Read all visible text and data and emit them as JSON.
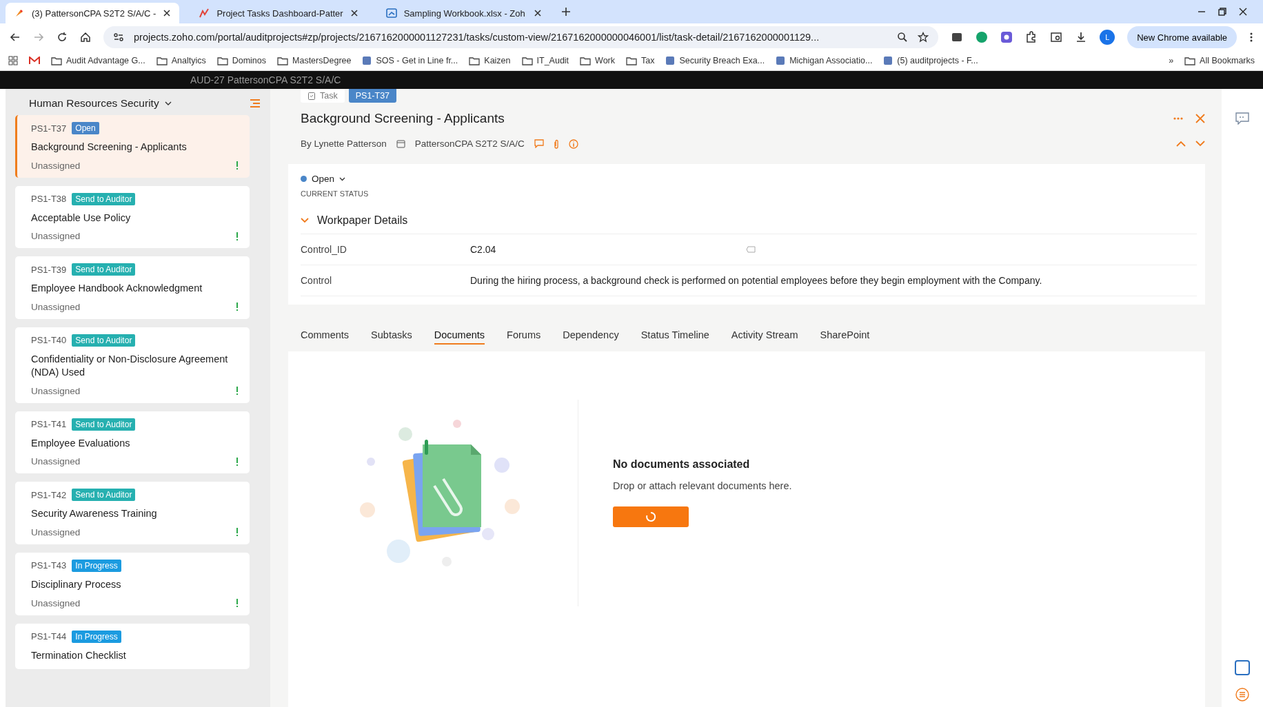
{
  "browser": {
    "tabs": [
      {
        "title": "(3) PattersonCPA S2T2 S/A/C -",
        "selected": true,
        "kind": "task"
      },
      {
        "title": "Project Tasks Dashboard-Patter",
        "selected": false,
        "kind": "dashboard"
      },
      {
        "title": "Sampling Workbook.xlsx - Zoh",
        "selected": false,
        "kind": "sheet"
      }
    ],
    "url": "projects.zoho.com/portal/auditprojects#zp/projects/2167162000001127231/tasks/custom-view/2167162000000046001/list/task-detail/2167162000001129...",
    "profile_initial": "L",
    "update_button": "New Chrome available",
    "bookmarks": [
      {
        "label": "Audit Advantage G...",
        "kind": "folder"
      },
      {
        "label": "Analtyics",
        "kind": "folder"
      },
      {
        "label": "Dominos",
        "kind": "folder"
      },
      {
        "label": "MastersDegree",
        "kind": "folder"
      },
      {
        "label": "SOS - Get in Line fr...",
        "kind": "site"
      },
      {
        "label": "Kaizen",
        "kind": "folder"
      },
      {
        "label": "IT_Audit",
        "kind": "folder"
      },
      {
        "label": "Work",
        "kind": "folder"
      },
      {
        "label": "Tax",
        "kind": "folder"
      },
      {
        "label": "Security Breach Exa...",
        "kind": "site"
      },
      {
        "label": "Michigan Associatio...",
        "kind": "site"
      },
      {
        "label": "(5) auditprojects - F...",
        "kind": "site"
      }
    ],
    "more_bookmarks": "»",
    "all_bookmarks": "All Bookmarks"
  },
  "backdrop_title": "AUD-27 PattersonCPA S2T2 S/A/C",
  "sidebar": {
    "title": "Human Resources Security",
    "items": [
      {
        "id": "PS1-T37",
        "status": "Open",
        "color": "#4a86c8",
        "title": "Background Screening - Applicants",
        "owner": "Unassigned",
        "selected": true
      },
      {
        "id": "PS1-T38",
        "status": "Send to Auditor",
        "color": "#26b0b0",
        "title": "Acceptable Use Policy",
        "owner": "Unassigned",
        "selected": false
      },
      {
        "id": "PS1-T39",
        "status": "Send to Auditor",
        "color": "#26b0b0",
        "title": "Employee Handbook Acknowledgment",
        "owner": "Unassigned",
        "selected": false
      },
      {
        "id": "PS1-T40",
        "status": "Send to Auditor",
        "color": "#26b0b0",
        "title": "Confidentiality or Non-Disclosure Agreement (NDA) Used",
        "owner": "Unassigned",
        "selected": false
      },
      {
        "id": "PS1-T41",
        "status": "Send to Auditor",
        "color": "#26b0b0",
        "title": "Employee Evaluations",
        "owner": "Unassigned",
        "selected": false
      },
      {
        "id": "PS1-T42",
        "status": "Send to Auditor",
        "color": "#26b0b0",
        "title": "Security Awareness Training",
        "owner": "Unassigned",
        "selected": false
      },
      {
        "id": "PS1-T43",
        "status": "In Progress",
        "color": "#1b9be0",
        "title": "Disciplinary Process",
        "owner": "Unassigned",
        "selected": false
      },
      {
        "id": "PS1-T44",
        "status": "In Progress",
        "color": "#1b9be0",
        "title": "Termination Checklist",
        "selected": false
      }
    ]
  },
  "detail": {
    "type_label": "Task",
    "task_id": "PS1-T37",
    "title": "Background Screening - Applicants",
    "author": "By Lynette Patterson",
    "project": "PattersonCPA S2T2 S/A/C",
    "status": "Open",
    "status_caption": "CURRENT STATUS",
    "section": {
      "title": "Workpaper Details",
      "expanded": true,
      "fields": [
        {
          "label": "Control_ID",
          "value": "C2.04"
        },
        {
          "label": "Control",
          "value": "During the hiring process, a background check is performed on potential employees before they begin employment with the Company."
        }
      ]
    },
    "tabs": [
      {
        "label": "Comments",
        "selected": false
      },
      {
        "label": "Subtasks",
        "selected": false
      },
      {
        "label": "Documents",
        "selected": true
      },
      {
        "label": "Forums",
        "selected": false
      },
      {
        "label": "Dependency",
        "selected": false
      },
      {
        "label": "Status Timeline",
        "selected": false
      },
      {
        "label": "Activity Stream",
        "selected": false
      },
      {
        "label": "SharePoint",
        "selected": false
      }
    ],
    "empty": {
      "title": "No documents associated",
      "message": "Drop or attach relevant documents here."
    }
  }
}
